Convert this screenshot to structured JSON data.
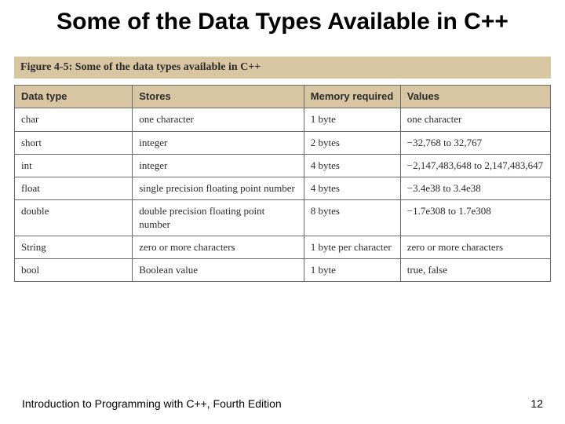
{
  "title": "Some of the Data Types Available in C++",
  "figure_caption": "Figure 4-5: Some of the data types available in C++",
  "table": {
    "headers": [
      "Data type",
      "Stores",
      "Memory required",
      "Values"
    ],
    "rows": [
      {
        "type": "char",
        "stores": "one character",
        "memory": "1 byte",
        "values": "one character"
      },
      {
        "type": "short",
        "stores": "integer",
        "memory": "2 bytes",
        "values": "−32,768 to 32,767"
      },
      {
        "type": "int",
        "stores": "integer",
        "memory": "4 bytes",
        "values": "−2,147,483,648 to 2,147,483,647"
      },
      {
        "type": "float",
        "stores": "single precision floating point number",
        "memory": "4 bytes",
        "values": "−3.4e38 to 3.4e38"
      },
      {
        "type": "double",
        "stores": "double precision floating point number",
        "memory": "8 bytes",
        "values": "−1.7e308 to 1.7e308"
      },
      {
        "type": "String",
        "stores": "zero or more characters",
        "memory": "1 byte per character",
        "values": "zero or more characters"
      },
      {
        "type": "bool",
        "stores": "Boolean value",
        "memory": "1 byte",
        "values": "true, false",
        "values_mono": true
      }
    ]
  },
  "footer": {
    "left": "Introduction to Programming with C++, Fourth Edition",
    "right": "12"
  },
  "chart_data": {
    "type": "table",
    "title": "Figure 4-5: Some of the data types available in C++",
    "columns": [
      "Data type",
      "Stores",
      "Memory required",
      "Values"
    ],
    "rows": [
      [
        "char",
        "one character",
        "1 byte",
        "one character"
      ],
      [
        "short",
        "integer",
        "2 bytes",
        "-32,768 to 32,767"
      ],
      [
        "int",
        "integer",
        "4 bytes",
        "-2,147,483,648 to 2,147,483,647"
      ],
      [
        "float",
        "single precision floating point number",
        "4 bytes",
        "-3.4e38 to 3.4e38"
      ],
      [
        "double",
        "double precision floating point number",
        "8 bytes",
        "-1.7e308 to 1.7e308"
      ],
      [
        "String",
        "zero or more characters",
        "1 byte per character",
        "zero or more characters"
      ],
      [
        "bool",
        "Boolean value",
        "1 byte",
        "true, false"
      ]
    ]
  }
}
